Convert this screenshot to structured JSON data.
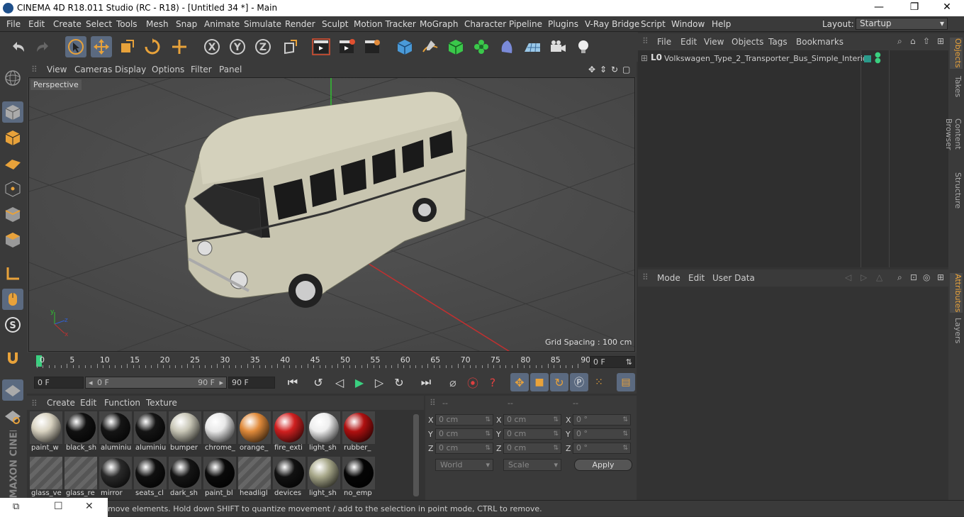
{
  "window": {
    "title": "CINEMA 4D R18.011 Studio (RC - R18) - [Untitled 34 *] - Main",
    "layout_label": "Layout:",
    "layout_value": "Startup"
  },
  "menubar": [
    "File",
    "Edit",
    "Create",
    "Select",
    "Tools",
    "Mesh",
    "Snap",
    "Animate",
    "Simulate",
    "Render",
    "Sculpt",
    "Motion Tracker",
    "MoGraph",
    "Character",
    "Pipeline",
    "Plugins",
    "V-Ray Bridge",
    "Script",
    "Window",
    "Help"
  ],
  "viewport": {
    "menu": [
      "View",
      "Cameras",
      "Display",
      "Options",
      "Filter",
      "Panel"
    ],
    "label": "Perspective",
    "grid_spacing": "Grid Spacing : 100 cm"
  },
  "timeline": {
    "ticks": [
      "0",
      "5",
      "10",
      "15",
      "20",
      "25",
      "30",
      "35",
      "40",
      "45",
      "50",
      "55",
      "60",
      "65",
      "70",
      "75",
      "80",
      "85",
      "90"
    ],
    "current_frame": "0 F",
    "start_field": "0 F",
    "range_start": "0 F",
    "range_end": "90 F",
    "end_field": "90 F"
  },
  "materials": {
    "menu": [
      "Create",
      "Edit",
      "Function",
      "Texture"
    ],
    "row1": [
      {
        "label": "paint_w",
        "color": "#d8d2c0"
      },
      {
        "label": "black_sh",
        "color": "#111111"
      },
      {
        "label": "aluminiu",
        "color": "#151515"
      },
      {
        "label": "aluminiu",
        "color": "#151515"
      },
      {
        "label": "bumper",
        "color": "#c8c6b6"
      },
      {
        "label": "chrome_",
        "color": "#e8e8e8"
      },
      {
        "label": "orange_",
        "color": "#e08a3a"
      },
      {
        "label": "fire_exti",
        "color": "#d02020"
      },
      {
        "label": "light_sh",
        "color": "#eeeeee"
      },
      {
        "label": "rubber_",
        "color": "#b01010"
      }
    ],
    "row2": [
      {
        "label": "glass_ve",
        "color": "#666666"
      },
      {
        "label": "glass_re",
        "color": "#666666"
      },
      {
        "label": "mirror",
        "color": "#2a2a2a"
      },
      {
        "label": "seats_cl",
        "color": "#101010"
      },
      {
        "label": "dark_sh",
        "color": "#151515"
      },
      {
        "label": "paint_bl",
        "color": "#0a0a0a"
      },
      {
        "label": "headligl",
        "color": "#666666"
      },
      {
        "label": "devices",
        "color": "#111111"
      },
      {
        "label": "light_sh",
        "color": "#a8a88a"
      },
      {
        "label": "no_emp",
        "color": "#050505"
      }
    ]
  },
  "coords": {
    "headers": [
      "--",
      "--",
      "--"
    ],
    "rows": [
      {
        "axis": "X",
        "pos": "0 cm",
        "axis2": "X",
        "size": "0 cm",
        "axis3": "X",
        "rot": "0 °"
      },
      {
        "axis": "Y",
        "pos": "0 cm",
        "axis2": "Y",
        "size": "0 cm",
        "axis3": "Y",
        "rot": "0 °"
      },
      {
        "axis": "Z",
        "pos": "0 cm",
        "axis2": "Z",
        "size": "0 cm",
        "axis3": "Z",
        "rot": "0 °"
      }
    ],
    "world": "World",
    "scale": "Scale",
    "apply": "Apply"
  },
  "objects": {
    "menu": [
      "File",
      "Edit",
      "View",
      "Objects",
      "Tags",
      "Bookmarks"
    ],
    "item": "Volkswagen_Type_2_Transporter_Bus_Simple_Interior"
  },
  "attributes": {
    "menu": [
      "Mode",
      "Edit",
      "User Data"
    ]
  },
  "right_tabs_top": [
    "Objects",
    "Takes",
    "Content Browser",
    "Structure"
  ],
  "right_tabs_bottom": [
    "Attributes",
    "Layers"
  ],
  "brand": "MAXON CINEMA 4D",
  "status": "move elements. Hold down SHIFT to quantize movement / add to the selection in point mode, CTRL to remove."
}
